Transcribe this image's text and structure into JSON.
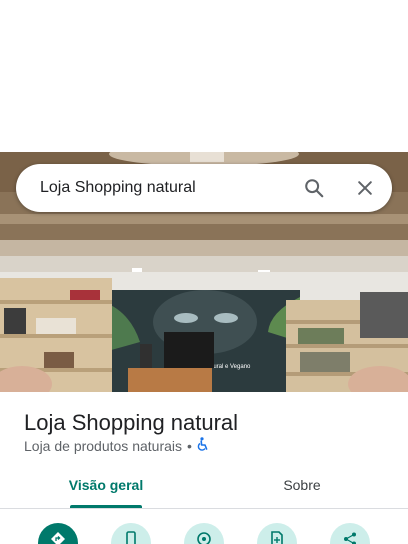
{
  "search": {
    "query": "Loja Shopping natural"
  },
  "place": {
    "name": "Loja Shopping natural",
    "category": "Loja de produtos naturais",
    "separator": "•"
  },
  "photo": {
    "sign_text": "Natural e Vegano"
  },
  "tabs": [
    {
      "label": "Visão geral",
      "selected": true
    },
    {
      "label": "Sobre",
      "selected": false
    }
  ],
  "actions": [
    {
      "icon": "directions-icon"
    },
    {
      "icon": "phone-icon"
    },
    {
      "icon": "location-icon"
    },
    {
      "icon": "save-icon"
    },
    {
      "icon": "share-icon"
    }
  ],
  "colors": {
    "accent": "#00796b",
    "action_bg": "#cdeeea",
    "text": "#202124",
    "subtext": "#5f6368"
  }
}
